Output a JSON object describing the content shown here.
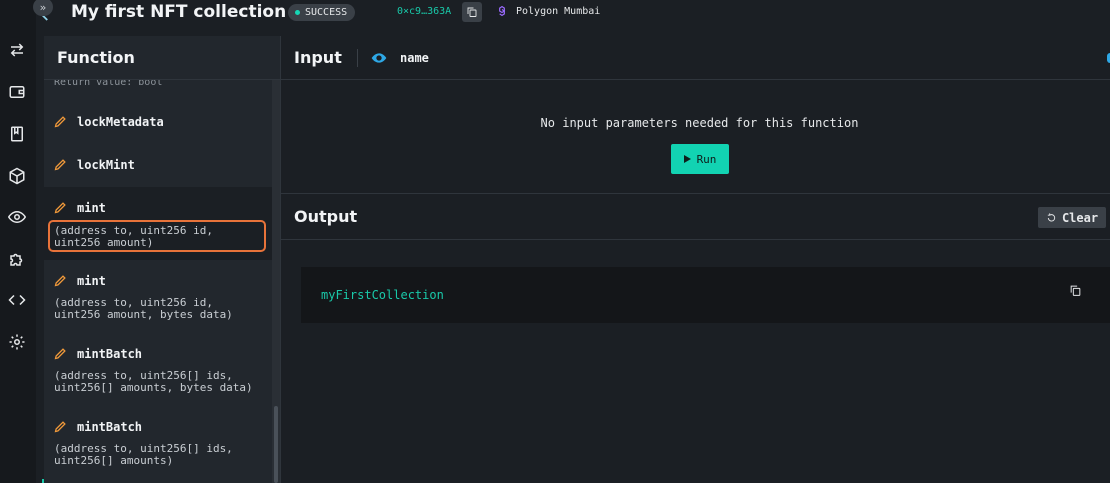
{
  "header": {
    "title": "My first NFT collection",
    "status": "SUCCESS",
    "address": "0×c9…363A",
    "network": "Polygon Mumbai"
  },
  "rail": {
    "expand": "»",
    "icons": [
      "transfer-icon",
      "wallet-icon",
      "book-icon",
      "cube-icon",
      "eye-icon",
      "puzzle-icon",
      "code-icon",
      "settings-icon"
    ]
  },
  "functions": {
    "title": "Function",
    "return_value": "Return value: bool",
    "items": [
      {
        "name": "lockMetadata",
        "params": ""
      },
      {
        "name": "lockMint",
        "params": ""
      },
      {
        "name": "mint",
        "params_line1": "(address to, uint256 id,",
        "params_line2": "uint256 amount)"
      },
      {
        "name": "mint",
        "params_line1": "(address to, uint256 id,",
        "params_line2": "uint256 amount, bytes data)"
      },
      {
        "name": "mintBatch",
        "params_line1": "(address to, uint256[] ids,",
        "params_line2": "uint256[] amounts, bytes data)"
      },
      {
        "name": "mintBatch",
        "params_line1": "(address to, uint256[] ids,",
        "params_line2": "uint256[] amounts)"
      }
    ]
  },
  "input": {
    "title": "Input",
    "function_name": "name",
    "message": "No input parameters needed for this function",
    "run_label": "Run"
  },
  "output": {
    "title": "Output",
    "clear_label": "Clear",
    "value": "myFirstCollection"
  },
  "colors": {
    "accent": "#12d3b2",
    "highlight": "#e8733a",
    "pencil": "#f29a3a",
    "eye": "#2ea8e6"
  }
}
